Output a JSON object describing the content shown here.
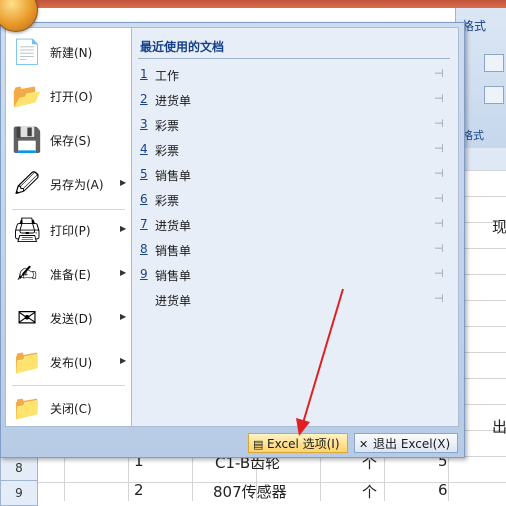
{
  "background": {
    "ribbon_tab": "格式",
    "ribbon_group": "格式",
    "formula_char": "现",
    "cell_text": "出",
    "rows": [
      {
        "row": "8",
        "no": "1",
        "name": "C1-B齿轮",
        "unit": "个",
        "qty": "5"
      },
      {
        "row": "9",
        "no": "2",
        "name": "807传感器",
        "unit": "个",
        "qty": "6"
      }
    ]
  },
  "office_button": {
    "icon": "office-logo-icon"
  },
  "menu": {
    "items": [
      {
        "label": "新建(N)",
        "icon": "new-document-icon",
        "has_submenu": false
      },
      {
        "label": "打开(O)",
        "icon": "open-folder-icon",
        "has_submenu": false
      },
      {
        "label": "保存(S)",
        "icon": "save-disk-icon",
        "has_submenu": false
      },
      {
        "label": "另存为(A)",
        "icon": "save-as-icon",
        "has_submenu": true
      },
      {
        "label": "打印(P)",
        "icon": "printer-icon",
        "has_submenu": true
      },
      {
        "label": "准备(E)",
        "icon": "prepare-pen-icon",
        "has_submenu": true
      },
      {
        "label": "发送(D)",
        "icon": "send-mail-icon",
        "has_submenu": true
      },
      {
        "label": "发布(U)",
        "icon": "publish-icon",
        "has_submenu": true
      },
      {
        "label": "关闭(C)",
        "icon": "close-folder-icon",
        "has_submenu": false
      }
    ],
    "submenu_arrow": "▶",
    "recent": {
      "title": "最近使用的文档",
      "pin": "⊣",
      "docs": [
        {
          "num": "1",
          "name": "工作"
        },
        {
          "num": "2",
          "name": "进货单"
        },
        {
          "num": "3",
          "name": "彩票"
        },
        {
          "num": "4",
          "name": "彩票"
        },
        {
          "num": "5",
          "name": "销售单"
        },
        {
          "num": "6",
          "name": "彩票"
        },
        {
          "num": "7",
          "name": "进货单"
        },
        {
          "num": "8",
          "name": "销售单"
        },
        {
          "num": "9",
          "name": "销售单"
        },
        {
          "num": "",
          "name": "进货单"
        }
      ]
    },
    "footer": {
      "options_label": "Excel 选项(I)",
      "exit_label": "退出 Excel(X)"
    }
  },
  "colors": {
    "annotation_arrow": "#e02020",
    "accent_blue": "#15428b"
  }
}
